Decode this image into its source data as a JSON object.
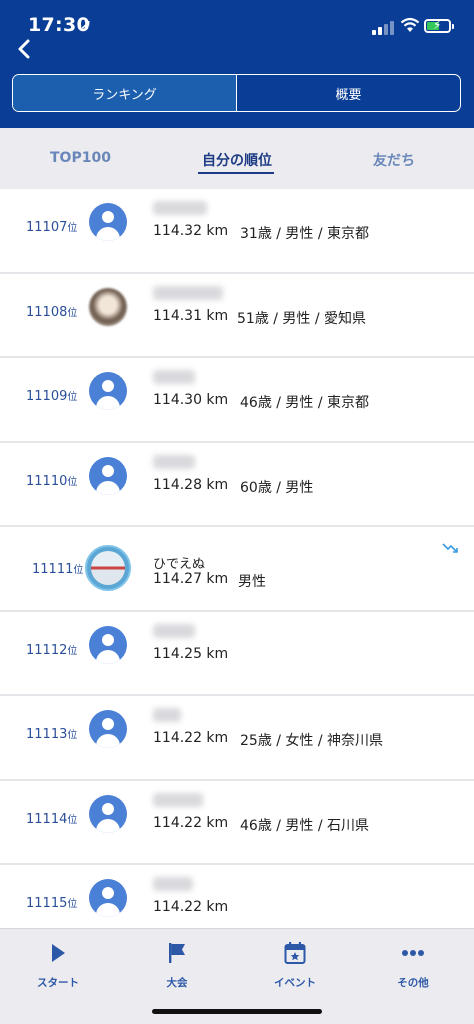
{
  "status_bar": {
    "time": "17:30",
    "location_glyph": "➚"
  },
  "segment": {
    "tabs": [
      {
        "label": "ランキング",
        "active": true
      },
      {
        "label": "概要",
        "active": false
      }
    ]
  },
  "subtabs": {
    "items": [
      {
        "label": "TOP100"
      },
      {
        "label": "自分の順位",
        "active": true
      },
      {
        "label": "友だち"
      }
    ]
  },
  "rank_suffix": "位",
  "rows": [
    {
      "rank": "11107",
      "distance": "114.32 km",
      "meta": "31歳 / 男性 / 東京都",
      "avatar": "default"
    },
    {
      "rank": "11108",
      "distance": "114.31 km",
      "meta": "51歳 / 男性 / 愛知県",
      "avatar": "photo"
    },
    {
      "rank": "11109",
      "distance": "114.30 km",
      "meta": "46歳 / 男性 / 東京都",
      "avatar": "default"
    },
    {
      "rank": "11110",
      "distance": "114.28 km",
      "meta": "60歳 / 男性",
      "avatar": "default"
    },
    {
      "rank": "11111",
      "name": "ひでえぬ",
      "distance": "114.27 km",
      "meta": "男性",
      "avatar": "photo-self",
      "trend": "down"
    },
    {
      "rank": "11112",
      "distance": "114.25 km",
      "meta": "",
      "avatar": "default"
    },
    {
      "rank": "11113",
      "distance": "114.22 km",
      "meta": "25歳 / 女性 / 神奈川県",
      "avatar": "default"
    },
    {
      "rank": "11114",
      "distance": "114.22 km",
      "meta": "46歳 / 男性 / 石川県",
      "avatar": "default"
    },
    {
      "rank": "11115",
      "distance": "114.22 km",
      "meta": "",
      "avatar": "default"
    }
  ],
  "tabbar": {
    "items": [
      {
        "label": "スタート",
        "icon": "play-icon"
      },
      {
        "label": "大会",
        "icon": "flag-icon"
      },
      {
        "label": "イベント",
        "icon": "calendar-star-icon"
      },
      {
        "label": "その他",
        "icon": "more-icon"
      }
    ]
  },
  "colors": {
    "header": "#0a3d95",
    "accent": "#2d58a8",
    "avatar": "#4a80d6"
  }
}
